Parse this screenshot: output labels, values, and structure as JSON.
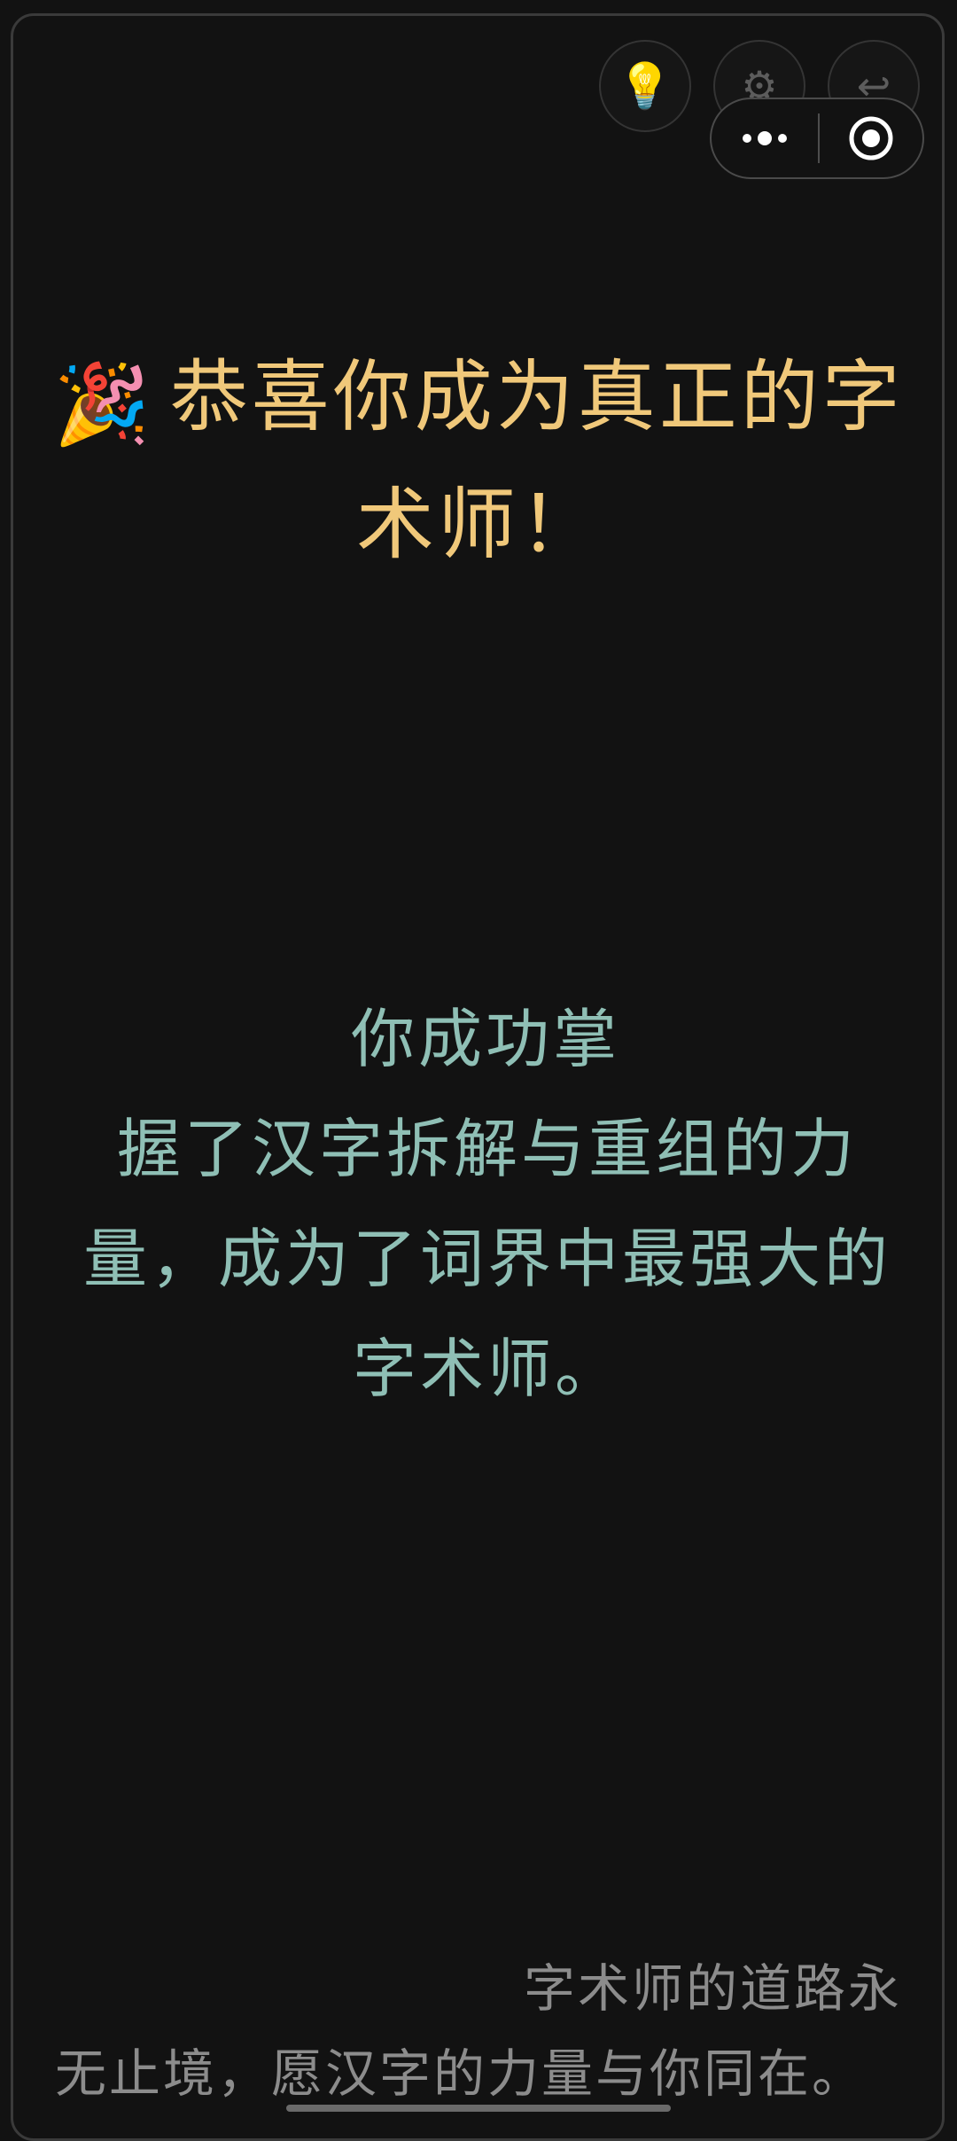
{
  "toolbar": {
    "hint_icon": "lightbulb-icon",
    "settings_icon": "gear-icon",
    "back_icon": "return-arrow-icon",
    "hint_glyph": "💡",
    "settings_glyph": "⚙",
    "back_glyph": "↩"
  },
  "capsule": {
    "more_icon": "more-dots-icon",
    "close_icon": "target-circle-icon"
  },
  "title": {
    "emoji": "🎉",
    "text": "恭喜你成为真正的字术师！"
  },
  "message": {
    "lead": "你成功掌",
    "rest": "握了汉字拆解与重组的力量，成为了词界中最强大的字术师。"
  },
  "footer": {
    "lead": "字术师的道路永",
    "rest": "无止境，愿汉字的力量与你同在。"
  },
  "colors": {
    "background": "#121212",
    "title": "#f0c87a",
    "message": "#8fbfb5",
    "footer": "#8c8c8c"
  }
}
